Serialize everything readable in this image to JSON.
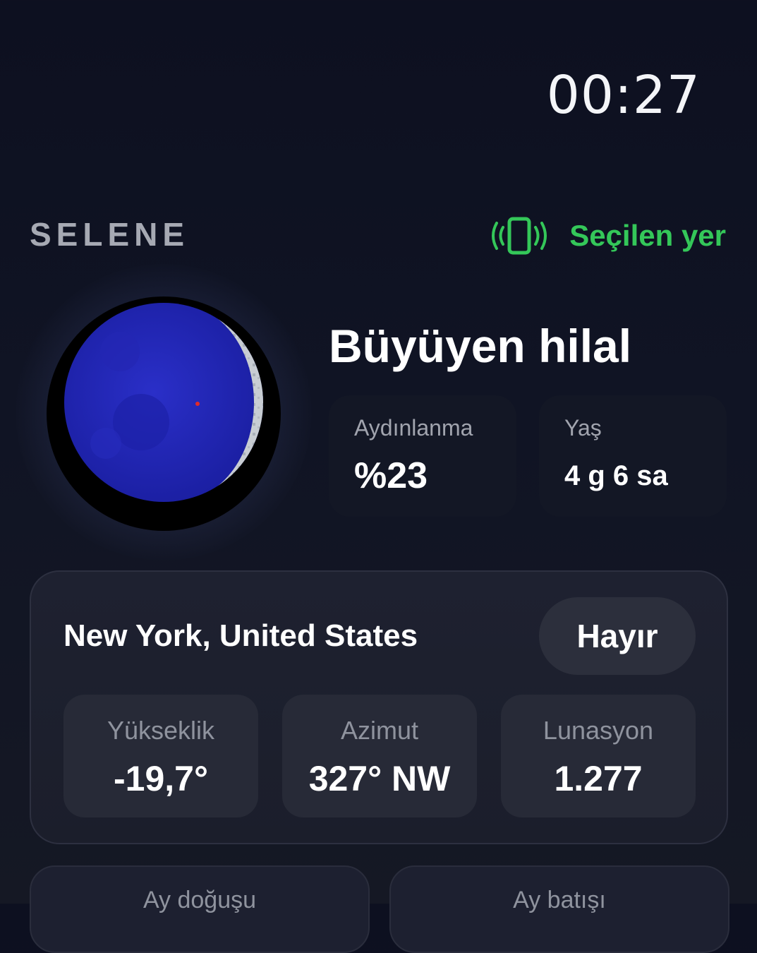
{
  "header": {
    "time": "00:27"
  },
  "app": {
    "name": "SELENE"
  },
  "location_selector": {
    "label": "Seçilen yer",
    "icon": "phone-vibrate-icon",
    "color": "#34c759"
  },
  "moon": {
    "phase_name": "Büyüyen hilal",
    "illumination": {
      "label": "Aydınlanma",
      "value": "%23"
    },
    "age": {
      "label": "Yaş",
      "value": "4 g 6 sa"
    }
  },
  "location": {
    "name": "New York, United States",
    "toggle_label": "Hayır",
    "metrics": [
      {
        "label": "Yükseklik",
        "value": "-19,7°"
      },
      {
        "label": "Azimut",
        "value": "327° NW"
      },
      {
        "label": "Lunasyon",
        "value": "1.277"
      }
    ]
  },
  "events": [
    {
      "label": "Ay doğuşu"
    },
    {
      "label": "Ay batışı"
    }
  ]
}
